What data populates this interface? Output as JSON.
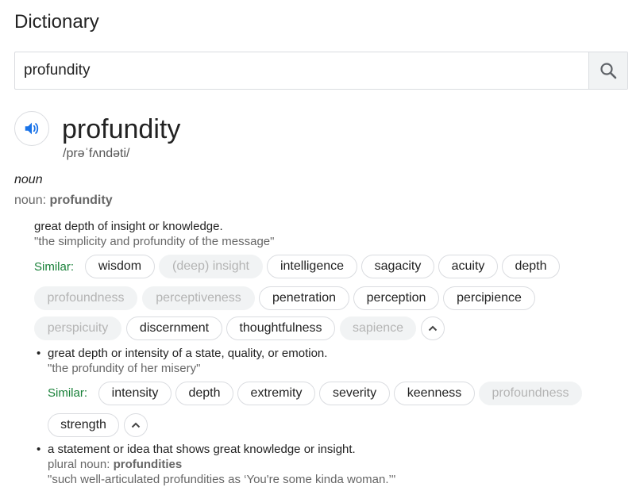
{
  "page": {
    "title": "Dictionary"
  },
  "search": {
    "value": "profundity"
  },
  "entry": {
    "word": "profundity",
    "pronunciation": "/prəˈfʌndəti/",
    "part_of_speech": "noun",
    "form_label": "noun:",
    "form_word": "profundity"
  },
  "senses": [
    {
      "definition": "great depth of insight or knowledge.",
      "example": "\"the simplicity and profundity of the message\"",
      "similar_label": "Similar:",
      "similar": [
        "wisdom",
        "(deep) insight",
        "intelligence",
        "sagacity",
        "acuity",
        "depth",
        "profoundness",
        "perceptiveness",
        "penetration",
        "perception",
        "percipience",
        "perspicuity",
        "discernment",
        "thoughtfulness",
        "sapience"
      ]
    },
    {
      "definition": "great depth or intensity of a state, quality, or emotion.",
      "example": "\"the profundity of her misery\"",
      "similar_label": "Similar:",
      "similar": [
        "intensity",
        "depth",
        "extremity",
        "severity",
        "keenness",
        "profoundness",
        "strength"
      ]
    },
    {
      "definition": "a statement or idea that shows great knowledge or insight.",
      "plural_label": "plural noun:",
      "plural_word": "profundities",
      "example": "\"such well-articulated profundities as ‘You're some kinda woman.’\""
    }
  ],
  "icons": {
    "search": "search-icon",
    "speaker": "speaker-icon",
    "collapse": "chevron-up-icon"
  },
  "colors": {
    "accent": "#1a73e8",
    "similar": "#188038"
  }
}
